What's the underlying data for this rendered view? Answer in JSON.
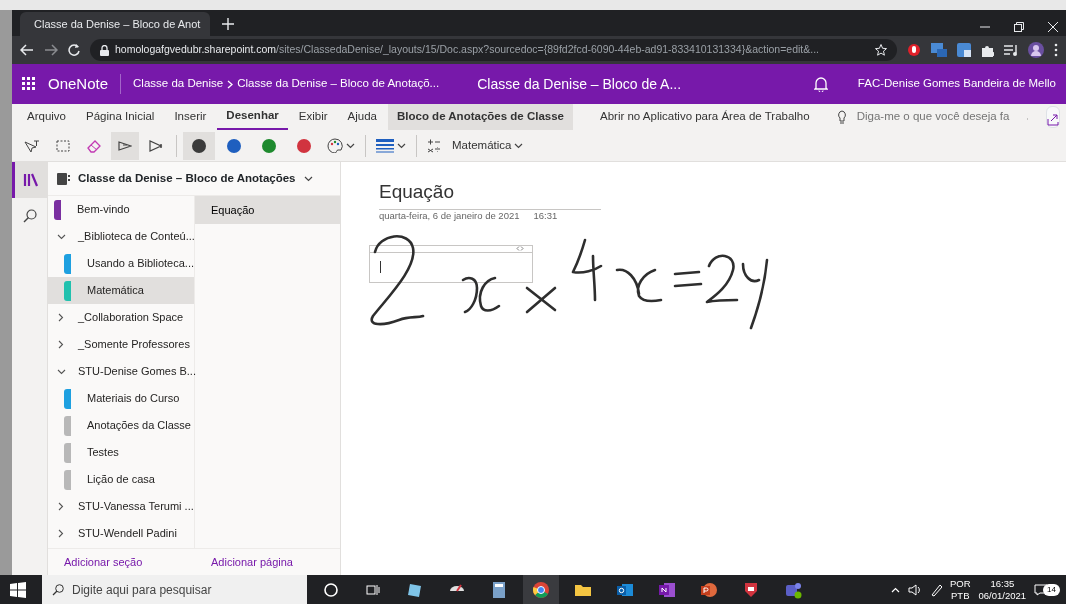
{
  "browser": {
    "tab_title": "Classe da Denise – Bloco de Anot",
    "url_host": "homologafgvedubr.sharepoint.com",
    "url_path": "/sites/ClassedaDenise/_layouts/15/Doc.aspx?sourcedoc={89fd2fcd-6090-44eb-ad91-833410131334}&action=edit&..."
  },
  "app_bar": {
    "app_name": "OneNote",
    "breadcrumbs": [
      "Classe da Denise",
      "Classe da Denise – Bloco de Anotaçõ..."
    ],
    "title": "Classe da Denise – Bloco de A...",
    "user": "FAC-Denise Gomes Bandeira de Mello"
  },
  "ribbon_tabs": [
    {
      "label": "Arquivo",
      "selected": false,
      "kind": "tab"
    },
    {
      "label": "Página Inicial",
      "selected": false,
      "kind": "tab"
    },
    {
      "label": "Inserir",
      "selected": false,
      "kind": "tab"
    },
    {
      "label": "Desenhar",
      "selected": true,
      "kind": "tab"
    },
    {
      "label": "Exibir",
      "selected": false,
      "kind": "tab"
    },
    {
      "label": "Ajuda",
      "selected": false,
      "kind": "tab"
    },
    {
      "label": "Bloco de Anotações de Classe",
      "selected": false,
      "kind": "contextual"
    },
    {
      "label": "Abrir no Aplicativo para Área de Trabalho",
      "selected": false,
      "kind": "link"
    }
  ],
  "tell_me": {
    "placeholder": "Diga-me o que você deseja fa"
  },
  "tools": [
    {
      "kind": "text-select",
      "selected": false
    },
    {
      "kind": "lasso",
      "selected": false
    },
    {
      "kind": "eraser",
      "selected": false
    },
    {
      "kind": "pen",
      "selected": true
    },
    {
      "kind": "highlighter",
      "selected": false
    }
  ],
  "pens": [
    {
      "color": "#3b3b3b",
      "selected": true
    },
    {
      "color": "#1f5fbf",
      "selected": false
    },
    {
      "color": "#1e8a2e",
      "selected": false
    },
    {
      "color": "#d1343f",
      "selected": false
    }
  ],
  "math_button": "Matemática",
  "notebook": {
    "name": "Classe da Denise – Bloco de Anotações"
  },
  "sections": [
    {
      "label": "Bem-vindo",
      "kind": "section",
      "color": "#7a2fa0",
      "selected": false
    },
    {
      "label": "_Biblioteca de Conteú...",
      "kind": "group",
      "expanded": true,
      "children": [
        {
          "label": "Usando a Biblioteca...",
          "kind": "section",
          "color": "#1ea0e0",
          "selected": false
        },
        {
          "label": "Matemática",
          "kind": "section",
          "color": "#21c1ae",
          "selected": true
        }
      ]
    },
    {
      "label": "_Collaboration Space",
      "kind": "group",
      "expanded": false
    },
    {
      "label": "_Somente Professores",
      "kind": "group",
      "expanded": false
    },
    {
      "label": "STU-Denise Gomes B...",
      "kind": "group",
      "expanded": true,
      "children": [
        {
          "label": "Materiais do Curso",
          "kind": "section",
          "color": "#1ea0e0",
          "selected": false
        },
        {
          "label": "Anotações da Classe",
          "kind": "section",
          "color": "#b8b8b8",
          "selected": false
        },
        {
          "label": "Testes",
          "kind": "section",
          "color": "#b8b8b8",
          "selected": false
        },
        {
          "label": "Lição de casa",
          "kind": "section",
          "color": "#b8b8b8",
          "selected": false
        }
      ]
    },
    {
      "label": "STU-Vanessa Terumi ...",
      "kind": "group",
      "expanded": false
    },
    {
      "label": "STU-Wendell Padini",
      "kind": "group",
      "expanded": false
    }
  ],
  "pages": [
    {
      "label": "Equação",
      "selected": true
    }
  ],
  "add_section": "Adicionar seção",
  "add_page": "Adicionar página",
  "page": {
    "title": "Equação",
    "date": "quarta-feira, 6 de janeiro de 2021",
    "time": "16:31"
  },
  "taskbar": {
    "search_placeholder": "Digite aqui para pesquisar",
    "language": "POR",
    "layout": "PTB",
    "time": "16:35",
    "date": "06/01/2021",
    "notifications": "14"
  }
}
